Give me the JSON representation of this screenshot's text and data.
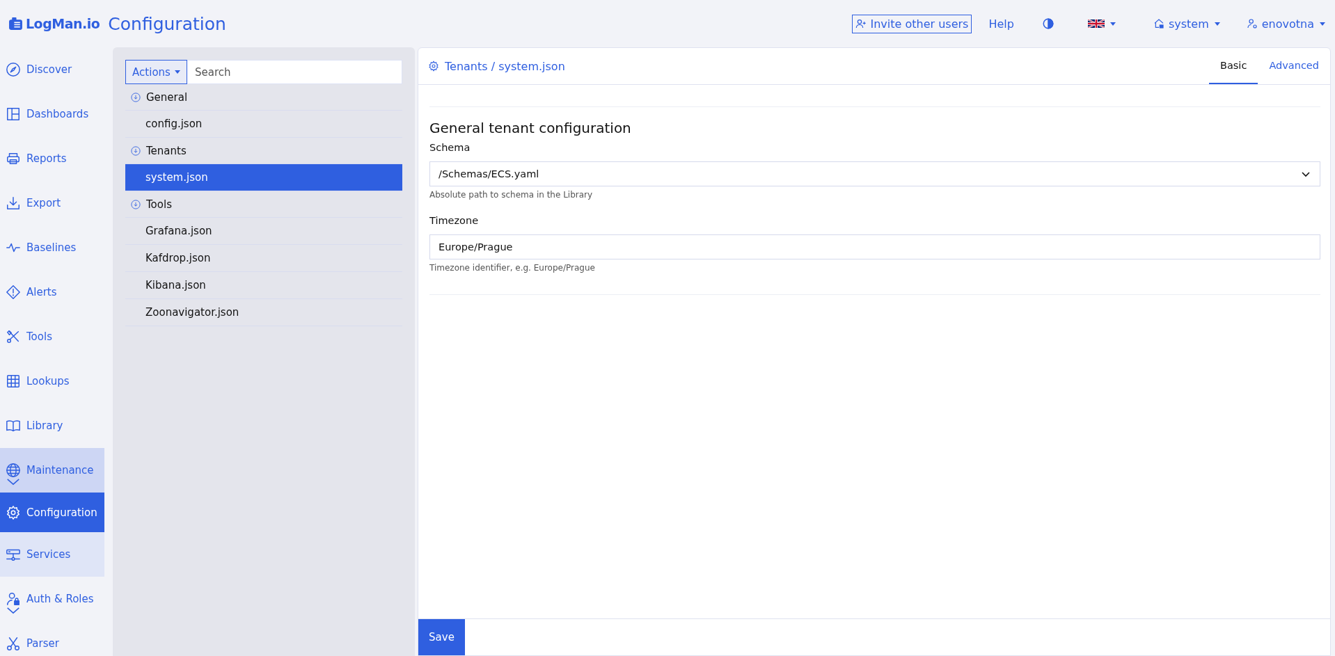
{
  "header": {
    "app_name": "LogMan.io",
    "page_title": "Configuration",
    "invite_button": "Invite other users",
    "help_link": "Help",
    "tenant": "system",
    "user": "enovotna"
  },
  "sidebar": {
    "items": [
      {
        "label": "Discover",
        "kind": "link",
        "selected": false
      },
      {
        "label": "Dashboards",
        "kind": "link",
        "selected": false
      },
      {
        "label": "Reports",
        "kind": "link",
        "selected": false
      },
      {
        "label": "Export",
        "kind": "link",
        "selected": false
      },
      {
        "label": "Baselines",
        "kind": "link",
        "selected": false
      },
      {
        "label": "Alerts",
        "kind": "link",
        "selected": false
      },
      {
        "label": "Tools",
        "kind": "link",
        "selected": false
      },
      {
        "label": "Lookups",
        "kind": "link",
        "selected": false
      },
      {
        "label": "Library",
        "kind": "link",
        "selected": false
      },
      {
        "label": "Maintenance",
        "kind": "group",
        "expanded": true,
        "selected": false,
        "children": [
          {
            "label": "Configuration",
            "selected": true
          },
          {
            "label": "Services",
            "selected": false
          }
        ]
      },
      {
        "label": "Auth & Roles",
        "kind": "group",
        "expanded": false,
        "selected": false
      },
      {
        "label": "Parser",
        "kind": "link",
        "selected": false
      }
    ]
  },
  "tree": {
    "actions_button": "Actions",
    "search": {
      "placeholder": "Search"
    },
    "groups": [
      {
        "label": "General",
        "expanded": true,
        "children": [
          {
            "label": "config.json",
            "selected": false
          }
        ]
      },
      {
        "label": "Tenants",
        "expanded": true,
        "children": [
          {
            "label": "system.json",
            "selected": true
          }
        ]
      },
      {
        "label": "Tools",
        "expanded": true,
        "children": [
          {
            "label": "Grafana.json",
            "selected": false
          },
          {
            "label": "Kafdrop.json",
            "selected": false
          },
          {
            "label": "Kibana.json",
            "selected": false
          },
          {
            "label": "Zoonavigator.json",
            "selected": false
          }
        ]
      }
    ]
  },
  "editor": {
    "breadcrumb": "Tenants / system.json",
    "tabs": [
      {
        "label": "Basic",
        "selected": true
      },
      {
        "label": "Advanced",
        "selected": false
      }
    ],
    "section_title": "General tenant configuration",
    "fields": [
      {
        "kind": "select",
        "label": "Schema",
        "value": "/Schemas/ECS.yaml",
        "help": "Absolute path to schema in the Library"
      },
      {
        "kind": "text",
        "label": "Timezone",
        "value": "Europe/Prague",
        "help": "Timezone identifier, e.g. Europe/Prague"
      }
    ],
    "save_button": "Save"
  }
}
